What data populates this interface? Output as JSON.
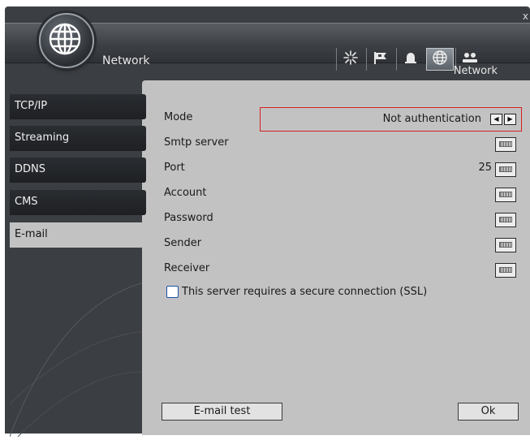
{
  "window": {
    "close_label": "x",
    "title": "Network",
    "section_label": "Network"
  },
  "toolbar": {
    "items": [
      {
        "icon": "snowflake-icon"
      },
      {
        "icon": "flag-icon"
      },
      {
        "icon": "alarm-icon"
      },
      {
        "icon": "globe-icon",
        "active": true
      },
      {
        "icon": "users-icon"
      }
    ]
  },
  "sidebar": {
    "items": [
      {
        "label": "TCP/IP"
      },
      {
        "label": "Streaming"
      },
      {
        "label": "DDNS"
      },
      {
        "label": "CMS"
      },
      {
        "label": "E-mail",
        "selected": true
      }
    ]
  },
  "form": {
    "mode_label": "Mode",
    "mode_value": "Not authentication",
    "smtp_label": "Smtp server",
    "smtp_value": "",
    "port_label": "Port",
    "port_value": "25",
    "account_label": "Account",
    "account_value": "",
    "password_label": "Password",
    "password_value": "",
    "sender_label": "Sender",
    "sender_value": "",
    "receiver_label": "Receiver",
    "receiver_value": "",
    "ssl_label": "This server requires a secure connection (SSL)",
    "ssl_checked": false
  },
  "buttons": {
    "email_test": "E-mail test",
    "ok": "Ok"
  },
  "colors": {
    "highlight_border": "#d42020",
    "panel_bg": "#c2c2c2",
    "frame_bg": "#3b3e42",
    "checkbox_border": "#1d4fa8"
  }
}
